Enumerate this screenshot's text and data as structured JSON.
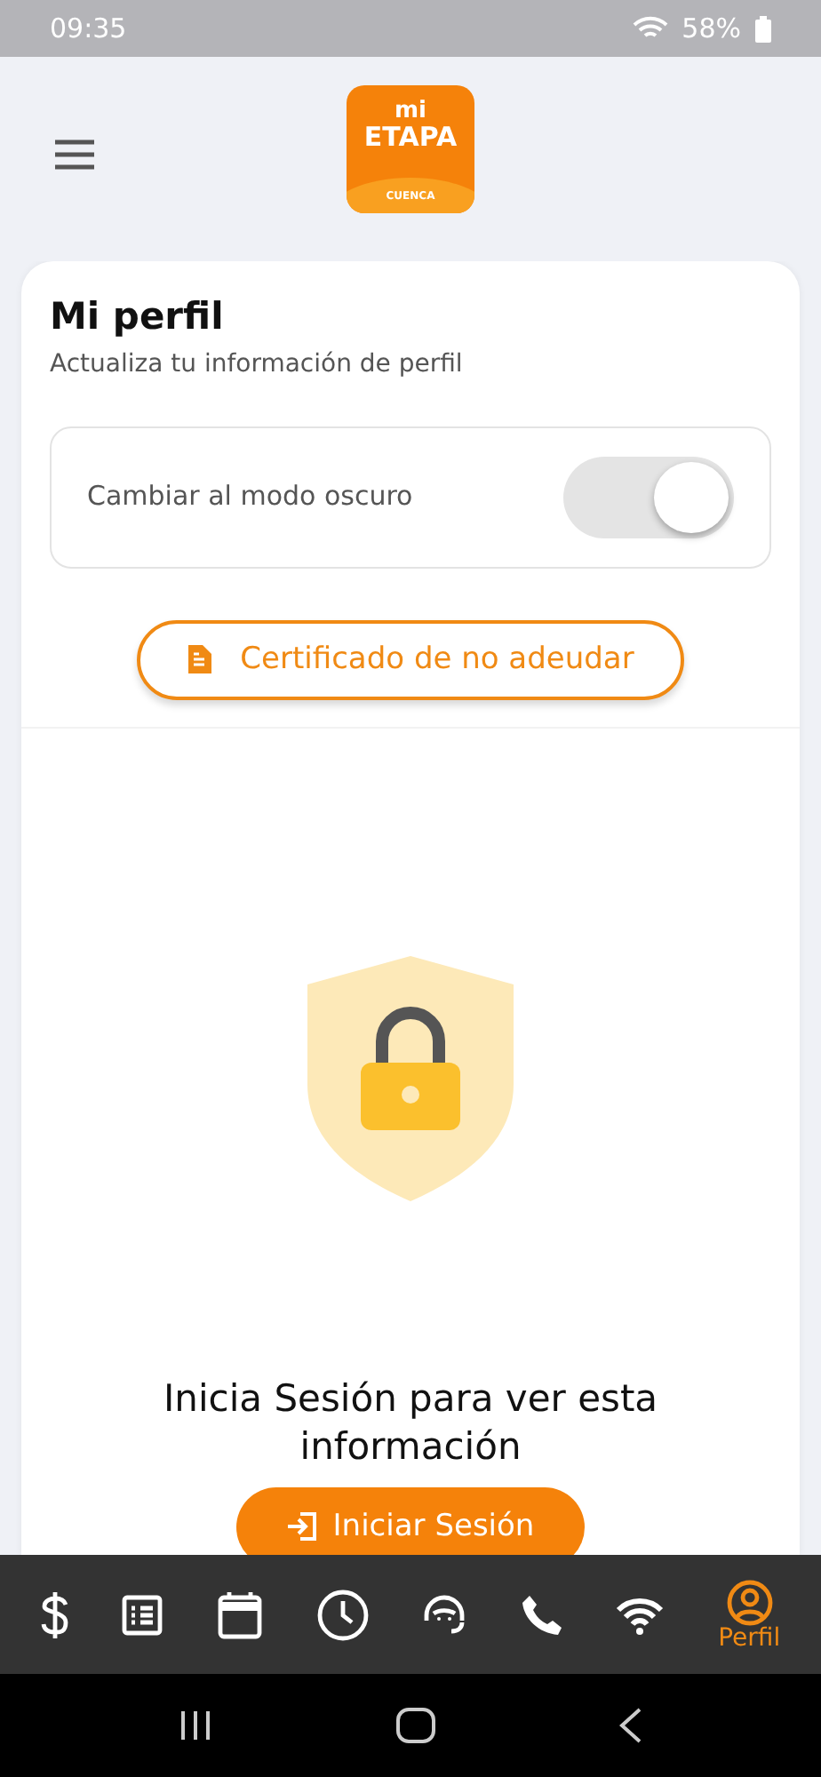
{
  "status_bar": {
    "time": "09:35",
    "battery": "58%"
  },
  "header": {
    "logo": {
      "line_1": "mi",
      "line_2": "ETAPA",
      "footer": "CUENCA"
    }
  },
  "profile": {
    "title": "Mi perfil",
    "subtitle": "Actualiza tu información de perfil",
    "dark_mode": {
      "label": "Cambiar al modo oscuro",
      "on": true
    },
    "certificate_button": "Certificado de no adeudar",
    "login_prompt": "Inicia Sesión para ver esta información",
    "login_button": "Iniciar Sesión"
  },
  "bottom_nav": [
    {
      "kind": "dollar",
      "selected": false
    },
    {
      "kind": "list",
      "selected": false
    },
    {
      "kind": "calendar",
      "selected": false
    },
    {
      "kind": "clock",
      "selected": false
    },
    {
      "kind": "headset",
      "selected": false
    },
    {
      "kind": "phone",
      "selected": false
    },
    {
      "kind": "wifi",
      "selected": false
    },
    {
      "kind": "profile",
      "label": "Perfil",
      "selected": true
    }
  ]
}
